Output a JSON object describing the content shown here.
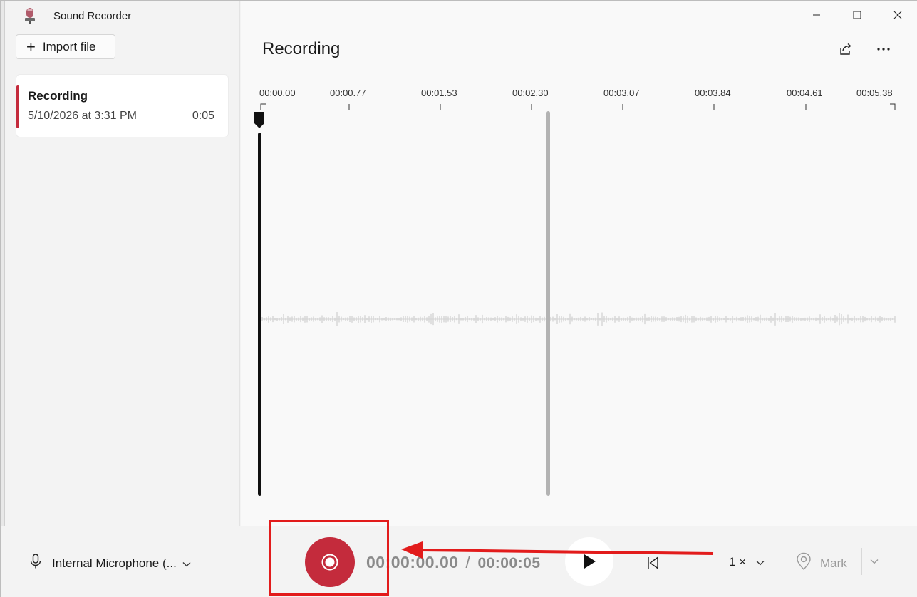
{
  "window": {
    "title": "Sound Recorder",
    "controls": [
      "minimize",
      "maximize",
      "close"
    ]
  },
  "sidebar": {
    "import_label": "Import file",
    "recordings": [
      {
        "name": "Recording",
        "date": "5/10/2026 at 3:31 PM",
        "duration": "0:05"
      }
    ]
  },
  "main": {
    "title": "Recording",
    "ticks": [
      "00:00.00",
      "00:00.77",
      "00:01.53",
      "00:02.30",
      "00:03.07",
      "00:03.84",
      "00:04.61",
      "00:05.38"
    ],
    "playhead_position": "00:00.00",
    "marker_position": "00:02.30"
  },
  "bottom": {
    "microphone": "Internal Microphone (...",
    "current_time": "00:00:00.00",
    "separator": "/",
    "total_time": "00:00:05",
    "speed": "1 ×",
    "mark_label": "Mark"
  },
  "colors": {
    "accent": "#c42b3c",
    "annotation": "#e21b1b"
  },
  "icons": {
    "app": "microphone-app-icon",
    "import": "plus-icon",
    "share": "share-icon",
    "more": "more-icon",
    "mic": "microphone-icon",
    "record": "record-icon",
    "play": "play-icon",
    "restart": "skip-back-icon",
    "mark": "location-pin-icon"
  }
}
